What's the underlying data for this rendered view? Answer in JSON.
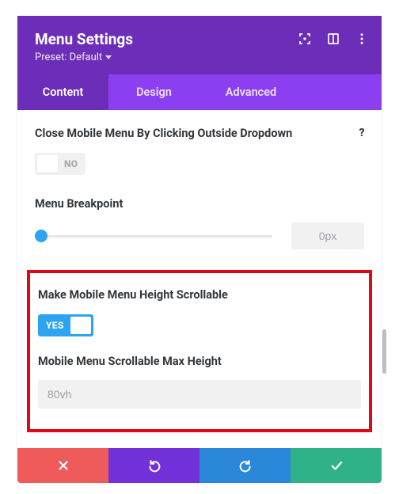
{
  "header": {
    "title": "Menu Settings",
    "preset_label": "Preset: Default"
  },
  "tabs": {
    "content": "Content",
    "design": "Design",
    "advanced": "Advanced"
  },
  "fields": {
    "close_outside": {
      "label": "Close Mobile Menu By Clicking Outside Dropdown",
      "value_text": "NO"
    },
    "breakpoint": {
      "label": "Menu Breakpoint",
      "value": "0px"
    },
    "scrollable": {
      "label": "Make Mobile Menu Height Scrollable",
      "value_text": "YES"
    },
    "max_height": {
      "label": "Mobile Menu Scrollable Max Height",
      "value": "80vh"
    }
  },
  "help_glyph": "?"
}
